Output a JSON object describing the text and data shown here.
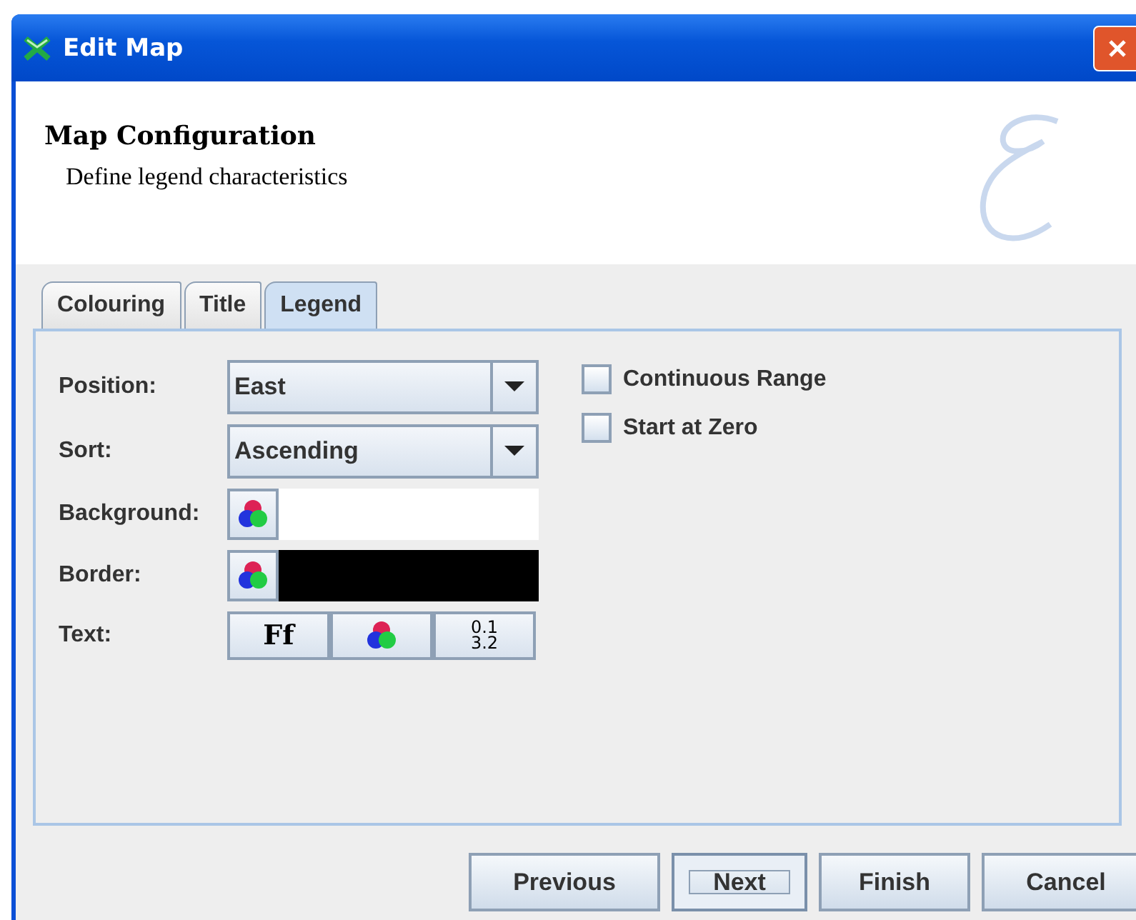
{
  "window": {
    "title": "Edit Map"
  },
  "header": {
    "title": "Map Configuration",
    "subtitle": "Define legend characteristics"
  },
  "tabs": [
    {
      "label": "Colouring",
      "selected": false
    },
    {
      "label": "Title",
      "selected": false
    },
    {
      "label": "Legend",
      "selected": true
    }
  ],
  "form": [
    {
      "kind": "combo",
      "label": "Position:",
      "value": "East"
    },
    {
      "kind": "combo",
      "label": "Sort:",
      "value": "Ascending"
    },
    {
      "kind": "color",
      "label": "Background:",
      "color": "#ffffff"
    },
    {
      "kind": "color",
      "label": "Border:",
      "color": "#000000"
    },
    {
      "kind": "text",
      "label": "Text:",
      "font_button": "Ff",
      "format_button": [
        "0.1",
        "3.2"
      ]
    }
  ],
  "options": [
    {
      "label": "Continuous Range",
      "checked": false
    },
    {
      "label": "Start at Zero",
      "checked": false
    }
  ],
  "buttons": [
    {
      "label": "Previous",
      "focused": false
    },
    {
      "label": "Next",
      "focused": true
    },
    {
      "label": "Finish",
      "focused": false
    },
    {
      "label": "Cancel",
      "focused": false
    }
  ]
}
